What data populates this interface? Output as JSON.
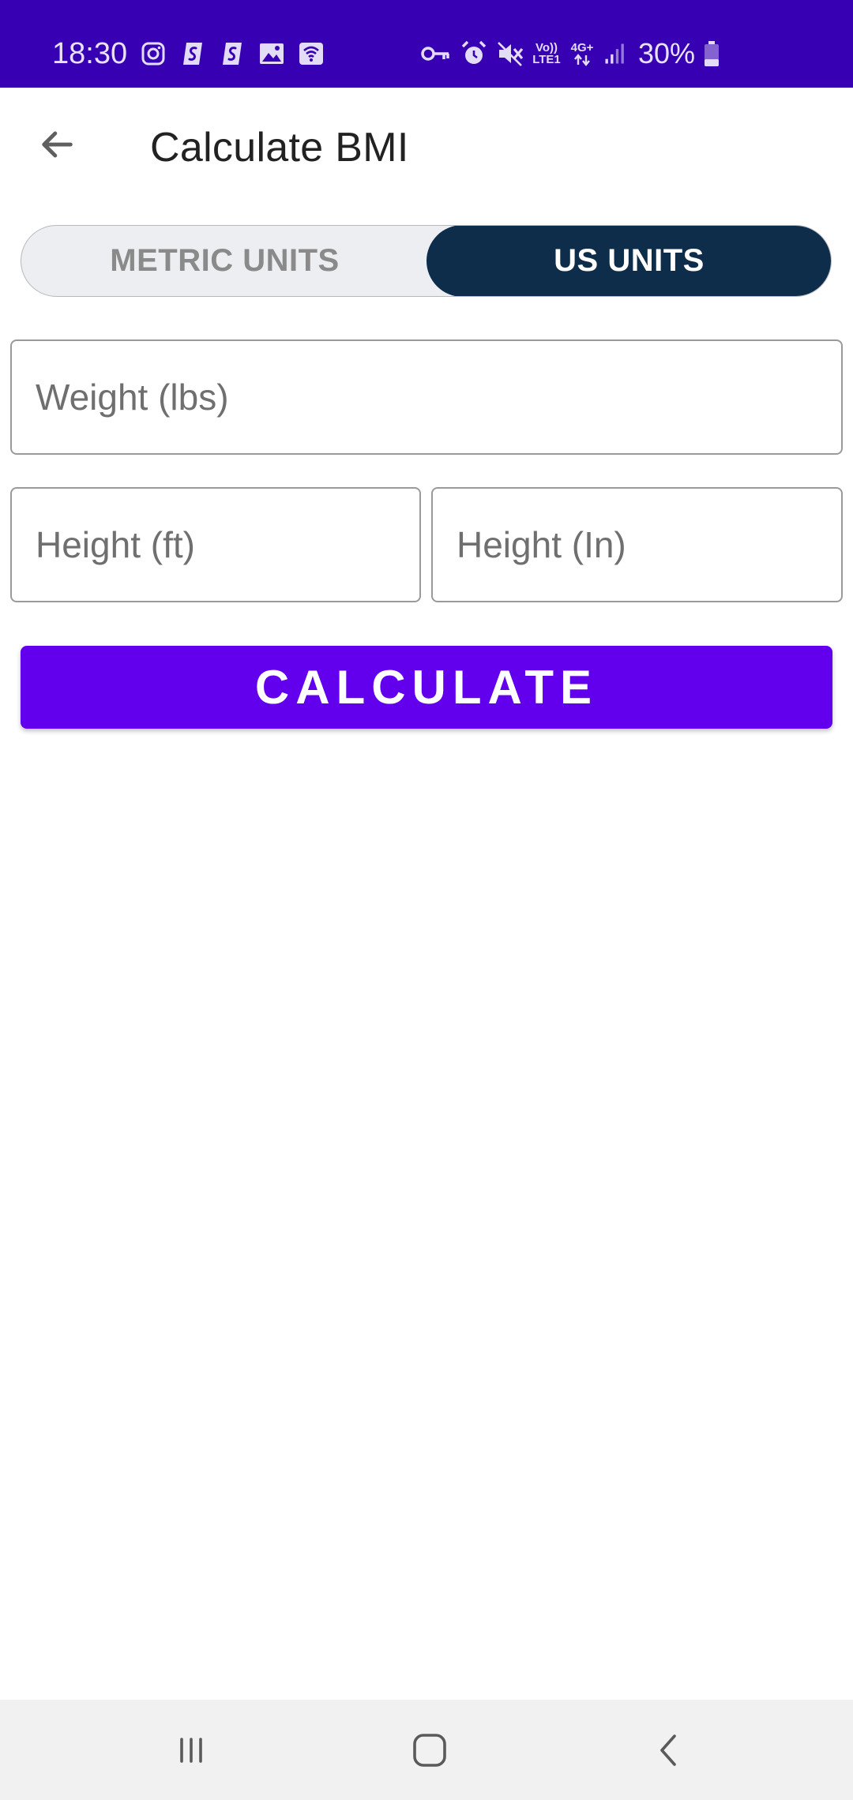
{
  "status_bar": {
    "time": "18:30",
    "network_top": "Vo))",
    "network_bottom": "LTE1",
    "network_gen": "4G+",
    "battery": "30%"
  },
  "toolbar": {
    "title": "Calculate BMI"
  },
  "unit_toggle": {
    "options": [
      {
        "label": "METRIC UNITS",
        "selected": false
      },
      {
        "label": "US UNITS",
        "selected": true
      }
    ]
  },
  "fields": {
    "weight": {
      "placeholder": "Weight (lbs)",
      "value": ""
    },
    "height_ft": {
      "placeholder": "Height (ft)",
      "value": ""
    },
    "height_in": {
      "placeholder": "Height (In)",
      "value": ""
    }
  },
  "calculate_button": {
    "label": "CALCULATE"
  },
  "colors": {
    "status_bar": "#3700b3",
    "toggle_selected": "#0d2d4b",
    "primary_button": "#6200ee",
    "nav_bar": "#f1f1f1"
  },
  "icons": {
    "status_left": [
      "instagram-icon",
      "shazam-icon",
      "shazam-icon",
      "image-icon",
      "wifi-calling-icon"
    ],
    "status_right": [
      "key-icon",
      "alarm-icon",
      "mute-icon",
      "signal-icon",
      "battery-icon"
    ],
    "navigation": [
      "recents-icon",
      "home-icon",
      "back-icon"
    ]
  }
}
